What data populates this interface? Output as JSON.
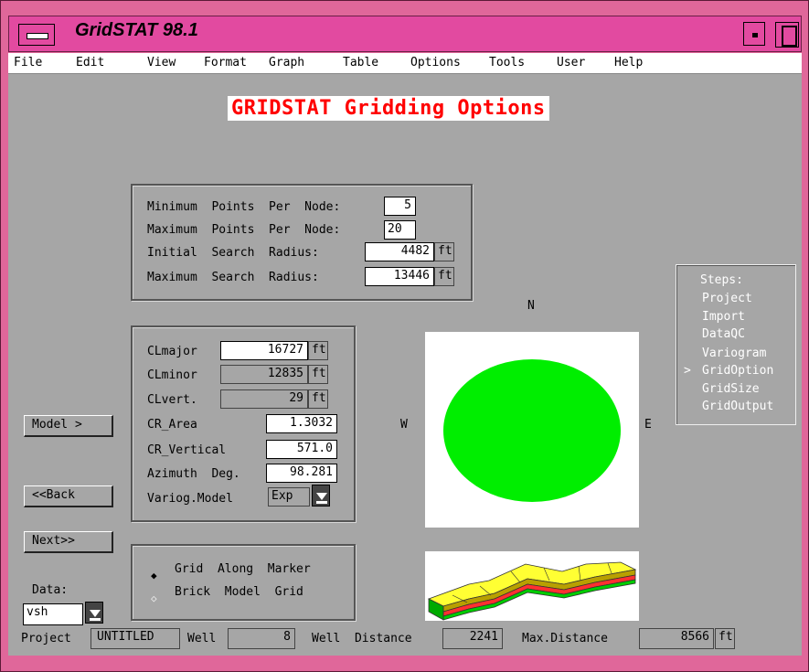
{
  "window": {
    "title": "GridSTAT 98.1"
  },
  "menubar": [
    "File",
    "Edit",
    "View",
    "Format",
    "Graph",
    "Table",
    "Options",
    "Tools",
    "User",
    "Help"
  ],
  "heading": "GRIDSTAT Gridding Options",
  "search": {
    "min_points_label": "Minimum  Points  Per  Node:",
    "min_points": "5",
    "max_points_label": "Maximum  Points  Per  Node:",
    "max_points": "20",
    "init_radius_label": "Initial  Search  Radius:",
    "init_radius": "4482",
    "init_radius_unit": "ft",
    "max_radius_label": "Maximum  Search  Radius:",
    "max_radius": "13446",
    "max_radius_unit": "ft"
  },
  "model": {
    "clmajor_label": "CLmajor",
    "clmajor": "16727",
    "clmajor_unit": "ft",
    "clminor_label": "CLminor",
    "clminor": "12835",
    "clminor_unit": "ft",
    "clvert_label": "CLvert.",
    "clvert": "29",
    "clvert_unit": "ft",
    "cr_area_label": "CR_Area",
    "cr_area": "1.3032",
    "cr_vertical_label": "CR_Vertical",
    "cr_vertical": "571.0",
    "azimuth_label": "Azimuth  Deg.",
    "azimuth": "98.281",
    "variog_label": "Variog.Model",
    "variog_value": "Exp"
  },
  "buttons": {
    "model": "Model  >",
    "back": "<<Back",
    "next": "Next>>"
  },
  "grid_options": {
    "opt1": "Grid  Along  Marker",
    "opt2": "Brick  Model  Grid",
    "opt1_selected": true
  },
  "data_select": {
    "label": "Data:",
    "value": "vsh"
  },
  "compass": {
    "n": "N",
    "w": "W",
    "e": "E"
  },
  "steps": {
    "title": "Steps:",
    "items": [
      "Project",
      "Import",
      "DataQC",
      "Variogram",
      "GridOption",
      "GridSize",
      "GridOutput"
    ],
    "current": "GridOption",
    "marker": ">"
  },
  "status": {
    "project_label": "Project",
    "project": "UNTITLED",
    "well_label": "Well",
    "well": "8",
    "well_distance_label": "Well  Distance",
    "well_distance": "2241",
    "max_distance_label": "Max.Distance",
    "max_distance": "8566",
    "unit": "ft"
  },
  "colors": {
    "titlebar": "#e24aa0",
    "frame": "#e0679a",
    "client": "#a6a6a6",
    "heading_text": "#ff0000",
    "ellipse": "#00ee00"
  }
}
